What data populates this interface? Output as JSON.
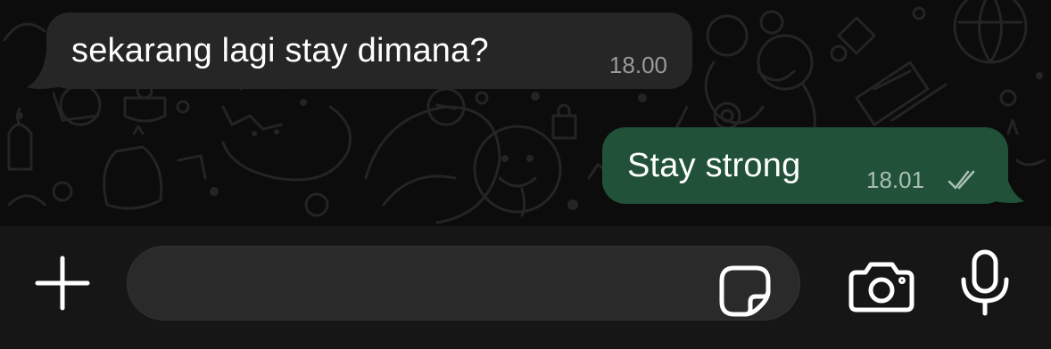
{
  "conversation": {
    "messages": [
      {
        "direction": "incoming",
        "text": "sekarang lagi stay dimana?",
        "time": "18.00"
      },
      {
        "direction": "outgoing",
        "text": "Stay strong",
        "time": "18.01",
        "status_icon": "double-check-read-icon"
      }
    ]
  },
  "composer": {
    "text_value": "",
    "icons": {
      "attach": "plus-icon",
      "sticker": "sticker-icon",
      "camera": "camera-icon",
      "voice": "microphone-icon"
    }
  },
  "colors": {
    "chat_background": "#0c0c0c",
    "incoming_bubble": "#262626",
    "outgoing_bubble": "#215139",
    "input_bar": "#161616",
    "input_field": "#2a2a2a"
  }
}
